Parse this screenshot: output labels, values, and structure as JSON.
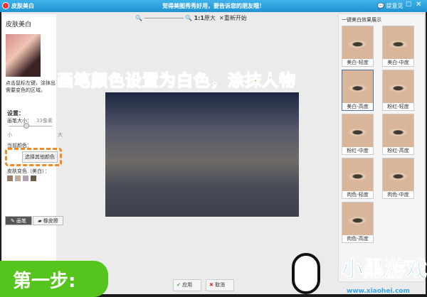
{
  "window": {
    "title": "皮肤美白",
    "center_text": "觉得美图秀秀好用，要告诉您的朋友哦！",
    "feedback": "提意见"
  },
  "left": {
    "header": "皮肤美白",
    "tip": "点击鼠标左键，涂抹出需要变色的区域。",
    "settings": "设置：",
    "brush_size_label": "画笔大小：",
    "brush_size_value": "33像素",
    "small": "小",
    "large": "大",
    "current_color": "当前颜色：",
    "pick_color": "选择其他颜色",
    "skin_colors_label": "皮肤变色（美白）：",
    "swatches": [
      "#9c7a6a",
      "#c2aa9a",
      "#b2a4b4",
      "#6b5a4a"
    ],
    "brush_tool": "画笔",
    "eraser_tool": "橡皮擦"
  },
  "toolbar": {
    "ratio": "1:1",
    "original": "原大",
    "reset": "重新开始"
  },
  "annotation": "画笔颜色设置为白色，涂抹人物",
  "right": {
    "header": "一键美白效果展示",
    "presets": [
      "美白-轻度",
      "美白-中度",
      "美白-高度",
      "粉红-轻度",
      "粉红-中度",
      "粉红-高度",
      "肉色-轻度",
      "肉色-中度",
      "肉色-高度"
    ]
  },
  "bottom": {
    "apply": "应用",
    "cancel": "取消",
    "step": "第一步:",
    "brand": "小黑游戏",
    "brand_url": "www.xiaohei.com"
  }
}
